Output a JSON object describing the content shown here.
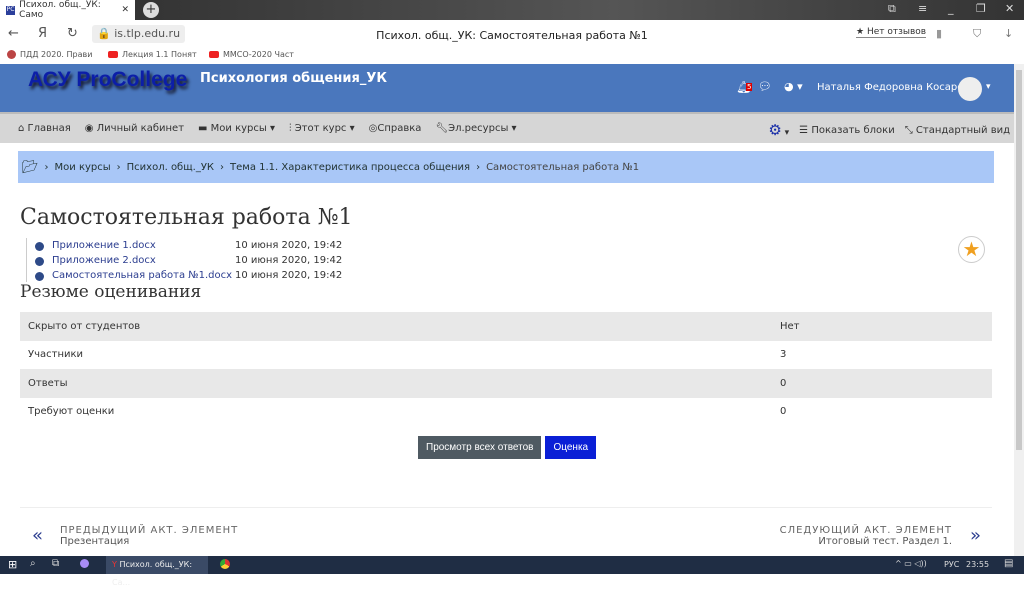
{
  "browser": {
    "tab_title": "Психол. общ._УК: Само",
    "url": "is.tlp.edu.ru",
    "page_title": "Психол. общ._УК: Самостоятельная работа №1",
    "reviews": "Нет отзывов",
    "bookmarks": [
      "ПДД 2020. Прави",
      "Лекция 1.1 Понят",
      "ММСО-2020 Част"
    ]
  },
  "header": {
    "logo": "АСУ ProCollege",
    "course": "Психология общения_УК",
    "notifications": "5",
    "user": "Наталья Федоровна Косарева"
  },
  "nav": {
    "items": [
      "Главная",
      "Личный кабинет",
      "Мои курсы",
      "Этот курс",
      "Справка",
      "Эл.ресурсы"
    ],
    "show_blocks": "Показать блоки",
    "standard_view": "Стандартный вид"
  },
  "breadcrumb": [
    "Мои курсы",
    "Психол. общ._УК",
    "Тема 1.1. Характеристика процесса общения",
    "Самостоятельная работа №1"
  ],
  "title": "Самостоятельная работа №1",
  "files": [
    {
      "name": "Приложение 1.docx",
      "date": "10 июня 2020, 19:42"
    },
    {
      "name": "Приложение 2.docx",
      "date": "10 июня 2020, 19:42"
    },
    {
      "name": "Самостоятельная работа №1.docx",
      "date": "10 июня 2020, 19:42"
    }
  ],
  "summary_title": "Резюме оценивания",
  "summary": [
    {
      "label": "Скрыто от студентов",
      "value": "Нет"
    },
    {
      "label": "Участники",
      "value": "3"
    },
    {
      "label": "Ответы",
      "value": "0"
    },
    {
      "label": "Требуют оценки",
      "value": "0"
    }
  ],
  "buttons": {
    "view_all": "Просмотр всех ответов",
    "grade": "Оценка"
  },
  "prev": {
    "label": "ПРЕДЫДУЩИЙ АКТ. ЭЛЕМЕНТ",
    "name": "Презентация"
  },
  "next": {
    "label": "СЛЕДУЮЩИЙ АКТ. ЭЛЕМЕНТ",
    "name": "Итоговый тест. Раздел 1."
  },
  "taskbar": {
    "app": "Психол. общ._УК: Са...",
    "lang": "РУС",
    "time": "23:55"
  },
  "colors": {
    "header": "#4a77bd",
    "breadcrumb": "#a9c7f7",
    "grade_button": "#0a1fd6",
    "view_button": "#4f5a62"
  }
}
